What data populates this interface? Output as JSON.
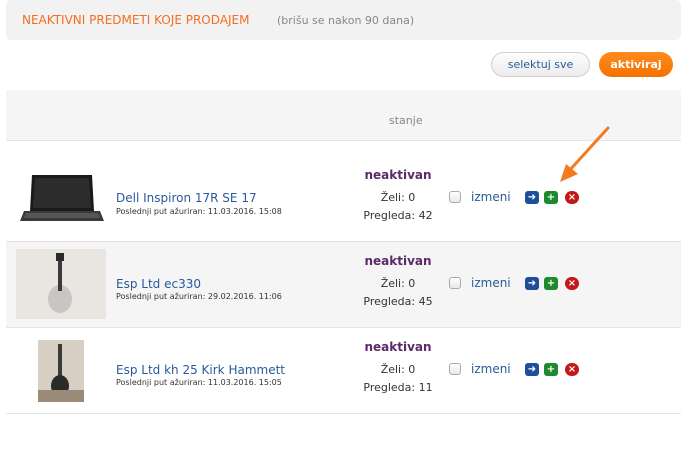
{
  "header": {
    "title": "NEAKTIVNI PREDMETI KOJE PRODAJEM",
    "note": "(brišu se nakon 90 dana)"
  },
  "toolbar": {
    "select_all_label": "selektuj sve",
    "activate_label": "aktiviraj"
  },
  "table": {
    "column_status": "stanje"
  },
  "colors": {
    "accent": "#f26f21",
    "link": "#2a5a9a",
    "status": "#5a2a6a",
    "move_icon": "#1f4f9a",
    "add_icon": "#1e8a2e",
    "delete_icon": "#c41818"
  },
  "items": [
    {
      "title": "Dell Inspiron 17R SE 17",
      "updated": "Poslednji put ažuriran: 11.03.2016. 15:08",
      "status": "neaktivan",
      "wants": "Želi: 0",
      "views": "Pregleda: 42",
      "edit_label": "izmeni",
      "thumb_icon": "laptop-image"
    },
    {
      "title": "Esp Ltd ec330",
      "updated": "Poslednji put ažuriran: 29.02.2016. 11:06",
      "status": "neaktivan",
      "wants": "Želi: 0",
      "views": "Pregleda: 45",
      "edit_label": "izmeni",
      "thumb_icon": "guitar-image"
    },
    {
      "title": "Esp Ltd kh 25 Kirk Hammett",
      "updated": "Poslednji put ažuriran: 11.03.2016. 15:05",
      "status": "neaktivan",
      "wants": "Želi: 0",
      "views": "Pregleda: 11",
      "edit_label": "izmeni",
      "thumb_icon": "guitar-image"
    }
  ],
  "icons": {
    "move": "arrow-right-icon",
    "add": "plus-icon",
    "delete": "close-icon",
    "annotation": "orange-arrow-icon"
  }
}
